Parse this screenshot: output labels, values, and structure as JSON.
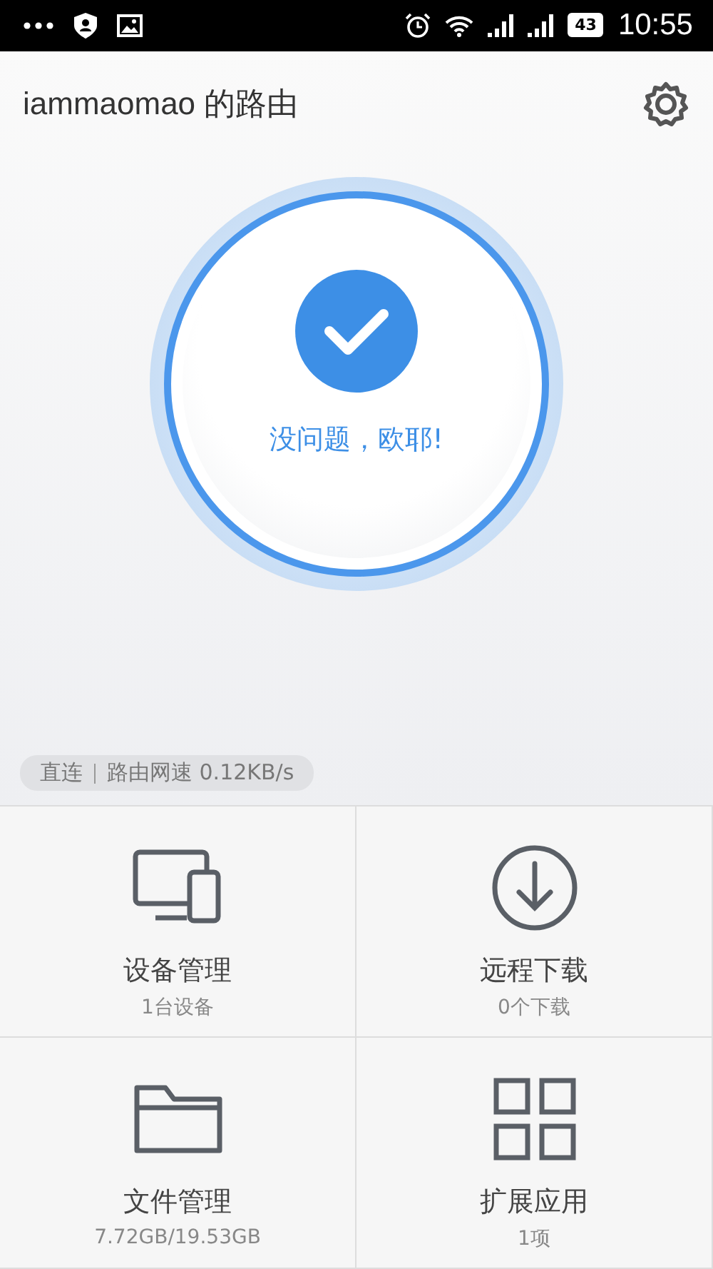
{
  "status_bar": {
    "battery": "43",
    "time": "10:55"
  },
  "header": {
    "title": "iammaomao 的路由"
  },
  "status": {
    "message": "没问题，欧耶!"
  },
  "connection": {
    "mode": "直连",
    "speed": "路由网速 0.12KB/s"
  },
  "tiles": [
    {
      "kind": "devices",
      "title": "设备管理",
      "subtitle": "1台设备"
    },
    {
      "kind": "download",
      "title": "远程下载",
      "subtitle": "0个下载"
    },
    {
      "kind": "files",
      "title": "文件管理",
      "subtitle": "7.72GB/19.53GB"
    },
    {
      "kind": "apps",
      "title": "扩展应用",
      "subtitle": "1项"
    }
  ]
}
